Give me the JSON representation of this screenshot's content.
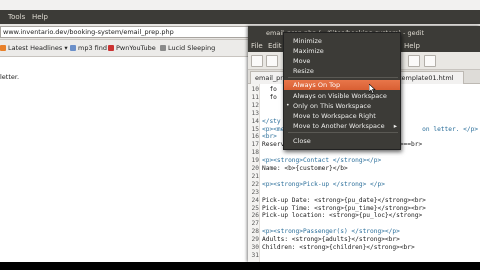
{
  "browser": {
    "menubar": {
      "items": [
        "Tools",
        "Help"
      ]
    },
    "url": "www.inventario.dev/booking-system/email_prep.php",
    "bookmarks": [
      {
        "label": "Latest Headlines",
        "icon": "rss-icon",
        "has_dropdown": true
      },
      {
        "label": "mp3 find",
        "icon": "music-icon",
        "has_dropdown": false
      },
      {
        "label": "PwnYouTube",
        "icon": "youtube-icon",
        "has_dropdown": false
      },
      {
        "label": "Lucid Sleeping",
        "icon": "folder-icon",
        "has_dropdown": false
      }
    ],
    "content_text": "letter."
  },
  "editor": {
    "title": "email_prep.php (~/Sites/booking-system) - gedit",
    "menubar": [
      "File",
      "Edit",
      "Help"
    ],
    "tabs": [
      {
        "label": "email_prep.php"
      },
      {
        "label": "template01.html"
      }
    ],
    "lines": [
      {
        "n": "10",
        "text": "  fo"
      },
      {
        "n": "11",
        "text": "  fo"
      },
      {
        "n": "12",
        "text": ""
      },
      {
        "n": "13",
        "text": ""
      },
      {
        "n": "14",
        "text": "</sty"
      },
      {
        "n": "15",
        "text": "<p><mean                                   on letter. </p>"
      },
      {
        "n": "16",
        "text": "<br>"
      },
      {
        "n": "17",
        "text": "Reserv                              g>==br>"
      },
      {
        "n": "18",
        "text": ""
      },
      {
        "n": "19",
        "text": "<p><strong>Contact </strong></p>"
      },
      {
        "n": "20",
        "text": "Name: <b>{customer}</b>"
      },
      {
        "n": "21",
        "text": ""
      },
      {
        "n": "22",
        "text": "<p><strong>Pick-up </strong> </p>"
      },
      {
        "n": "23",
        "text": ""
      },
      {
        "n": "24",
        "text": "Pick-up Date: <strong>{pu_date}</strong><br>"
      },
      {
        "n": "25",
        "text": "Pick-up Time: <strong>{pu_time}</strong><br>"
      },
      {
        "n": "26",
        "text": "Pick-up location: <strong>{pu_loc}</strong>"
      },
      {
        "n": "27",
        "text": ""
      },
      {
        "n": "28",
        "text": "<p><strong>Passenger(s) </strong></p>"
      },
      {
        "n": "29",
        "text": "Adults: <strong>{adults}</strong><br>"
      },
      {
        "n": "30",
        "text": "Children: <strong>{children}</strong><br>"
      },
      {
        "n": "31",
        "text": ""
      }
    ]
  },
  "window_menu": {
    "items": [
      {
        "label": "Minimize",
        "highlighted": false,
        "mark": "",
        "submenu": false
      },
      {
        "label": "Maximize",
        "highlighted": false,
        "mark": "",
        "submenu": false
      },
      {
        "label": "Move",
        "highlighted": false,
        "mark": "",
        "submenu": false
      },
      {
        "label": "Resize",
        "highlighted": false,
        "mark": "",
        "submenu": false
      },
      {
        "label": "Always On Top",
        "highlighted": true,
        "mark": "",
        "submenu": false
      },
      {
        "label": "Always on Visible Workspace",
        "highlighted": false,
        "mark": "",
        "submenu": false
      },
      {
        "label": "Only on This Workspace",
        "highlighted": false,
        "mark": "•",
        "submenu": false
      },
      {
        "label": "Move to Workspace Right",
        "highlighted": false,
        "mark": "",
        "submenu": false
      },
      {
        "label": "Move to Another Workspace",
        "highlighted": false,
        "mark": "",
        "submenu": true
      },
      {
        "label": "Close",
        "highlighted": false,
        "mark": "",
        "submenu": false
      }
    ],
    "colors": {
      "background": "#3c3b37",
      "highlight": "#e8764a",
      "text": "#eeeeec"
    }
  }
}
